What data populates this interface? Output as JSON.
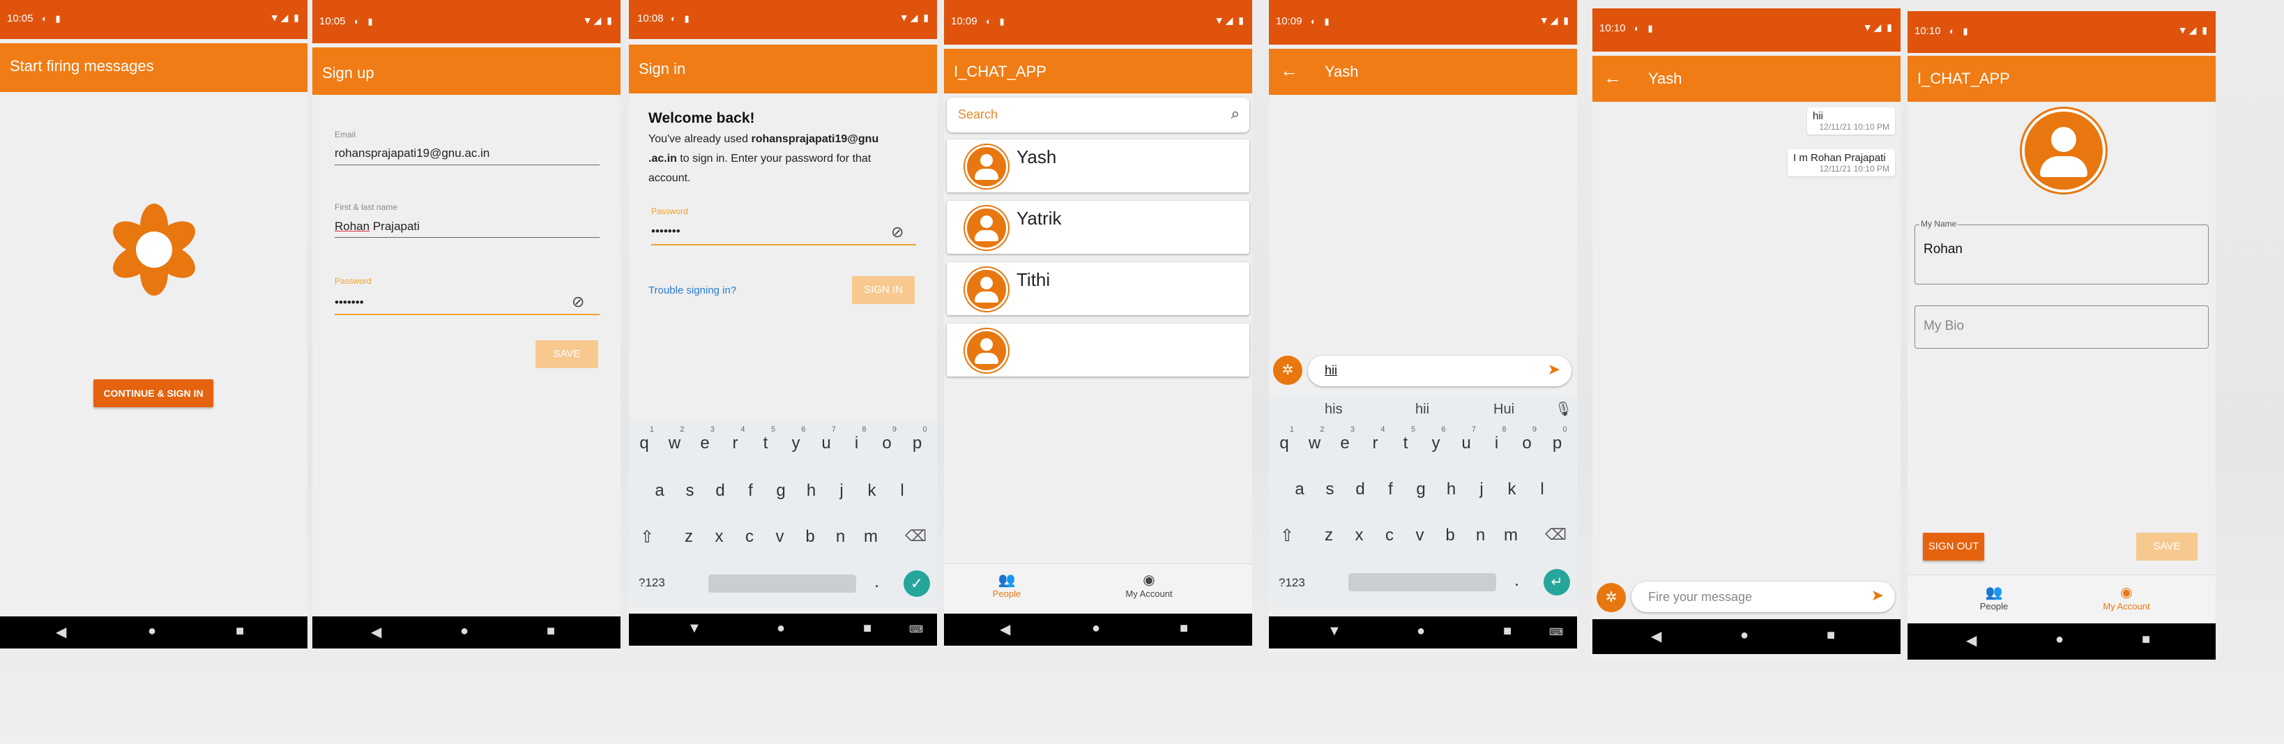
{
  "s1": {
    "time": "10:05",
    "title": "Start firing messages",
    "button": "CONTINUE & SIGN IN"
  },
  "s2": {
    "time": "10:05",
    "title": "Sign up",
    "email_label": "Email",
    "email_value": "rohansprajapati19@gnu.ac.in",
    "name_label": "First & last name",
    "name_value_first": "Rohan",
    "name_value_rest": " Prajapati",
    "password_label": "Password",
    "password_value": "•••••••",
    "save": "SAVE"
  },
  "s3": {
    "time": "10:08",
    "title": "Sign in",
    "welcome": "Welcome back!",
    "desc_pre": "You've already used ",
    "desc_email1": "rohansprajapati19@gnu",
    "desc_email2": ".ac.in",
    "desc_post1": " to sign in. Enter your password for that",
    "desc_post2": "account.",
    "password_label": "Password",
    "password_value": "•••••••",
    "trouble": "Trouble signing in?",
    "signin": "SIGN IN"
  },
  "keyboard": {
    "row1": [
      "q",
      "w",
      "e",
      "r",
      "t",
      "y",
      "u",
      "i",
      "o",
      "p"
    ],
    "row1_nums": [
      "1",
      "2",
      "3",
      "4",
      "5",
      "6",
      "7",
      "8",
      "9",
      "0"
    ],
    "row2": [
      "a",
      "s",
      "d",
      "f",
      "g",
      "h",
      "j",
      "k",
      "l"
    ],
    "row3": [
      "z",
      "x",
      "c",
      "v",
      "b",
      "n",
      "m"
    ],
    "sym": "?123",
    "period": "."
  },
  "s4": {
    "time": "10:09",
    "title": "I_CHAT_APP",
    "search_placeholder": "Search",
    "contacts": [
      "Yash",
      "Yatrik",
      "Tithi",
      ""
    ],
    "nav_people": "People",
    "nav_account": "My Account"
  },
  "s5": {
    "time": "10:09",
    "title": "Yash",
    "input": "hii",
    "suggestions": [
      "his",
      "hii",
      "Hui"
    ]
  },
  "s6": {
    "time": "10:10",
    "title": "Yash",
    "messages": [
      {
        "text": "hii",
        "time": "12/11/21 10:10 PM"
      },
      {
        "text": "I m Rohan Prajapati",
        "time": "12/11/21 10:10 PM"
      }
    ],
    "placeholder": "Fire your message"
  },
  "s7": {
    "time": "10:10",
    "title": "I_CHAT_APP",
    "name_label": "My Name",
    "name_value": "Rohan",
    "bio_placeholder": "My Bio",
    "signout": "SIGN OUT",
    "save": "SAVE",
    "nav_people": "People",
    "nav_account": "My Account"
  },
  "colors": {
    "status": "#e0530c",
    "appbar": "#f07c15",
    "accent": "#e8770f"
  }
}
